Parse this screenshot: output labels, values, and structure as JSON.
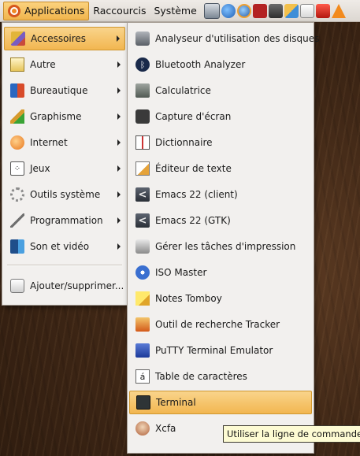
{
  "panel": {
    "menus": [
      "Applications",
      "Raccourcis",
      "Système"
    ],
    "launchers": [
      "monitor-icon",
      "globe-icon",
      "thunderbird-icon",
      "filezilla-icon",
      "gimp-icon",
      "network-icon",
      "files-icon",
      "pdf-icon",
      "vlc-icon"
    ]
  },
  "applications_menu": {
    "items": [
      {
        "label": "Accessoires",
        "icon": "accessories-icon"
      },
      {
        "label": "Autre",
        "icon": "other-icon"
      },
      {
        "label": "Bureautique",
        "icon": "office-icon"
      },
      {
        "label": "Graphisme",
        "icon": "graphics-icon"
      },
      {
        "label": "Internet",
        "icon": "internet-icon"
      },
      {
        "label": "Jeux",
        "icon": "games-icon"
      },
      {
        "label": "Outils système",
        "icon": "system-tools-icon"
      },
      {
        "label": "Programmation",
        "icon": "programming-icon"
      },
      {
        "label": "Son et vidéo",
        "icon": "sound-video-icon"
      }
    ],
    "footer_item": {
      "label": "Ajouter/supprimer...",
      "icon": "add-remove-icon"
    }
  },
  "accessories_menu": {
    "items": [
      {
        "label": "Analyseur d'utilisation des disques",
        "icon": "disk-usage-icon"
      },
      {
        "label": "Bluetooth Analyzer",
        "icon": "bluetooth-icon"
      },
      {
        "label": "Calculatrice",
        "icon": "calculator-icon"
      },
      {
        "label": "Capture d'écran",
        "icon": "camera-icon"
      },
      {
        "label": "Dictionnaire",
        "icon": "dictionary-icon"
      },
      {
        "label": "Éditeur de texte",
        "icon": "text-editor-icon"
      },
      {
        "label": "Emacs 22 (client)",
        "icon": "emacs-icon"
      },
      {
        "label": "Emacs 22 (GTK)",
        "icon": "emacs-icon"
      },
      {
        "label": "Gérer les tâches d'impression",
        "icon": "printer-icon"
      },
      {
        "label": "ISO Master",
        "icon": "iso-master-icon"
      },
      {
        "label": "Notes Tomboy",
        "icon": "tomboy-icon"
      },
      {
        "label": "Outil de recherche Tracker",
        "icon": "tracker-search-icon"
      },
      {
        "label": "PuTTY Terminal Emulator",
        "icon": "putty-icon"
      },
      {
        "label": "Table de caractères",
        "icon": "character-map-icon"
      },
      {
        "label": "Terminal",
        "icon": "terminal-icon"
      },
      {
        "label": "Xcfa",
        "icon": "xcfa-icon"
      }
    ]
  },
  "tooltip": {
    "text": "Utiliser la ligne de commande"
  },
  "colors": {
    "highlight": "#f2b650",
    "menu_bg": "#f2f0ee",
    "desktop": "#3f2716"
  }
}
